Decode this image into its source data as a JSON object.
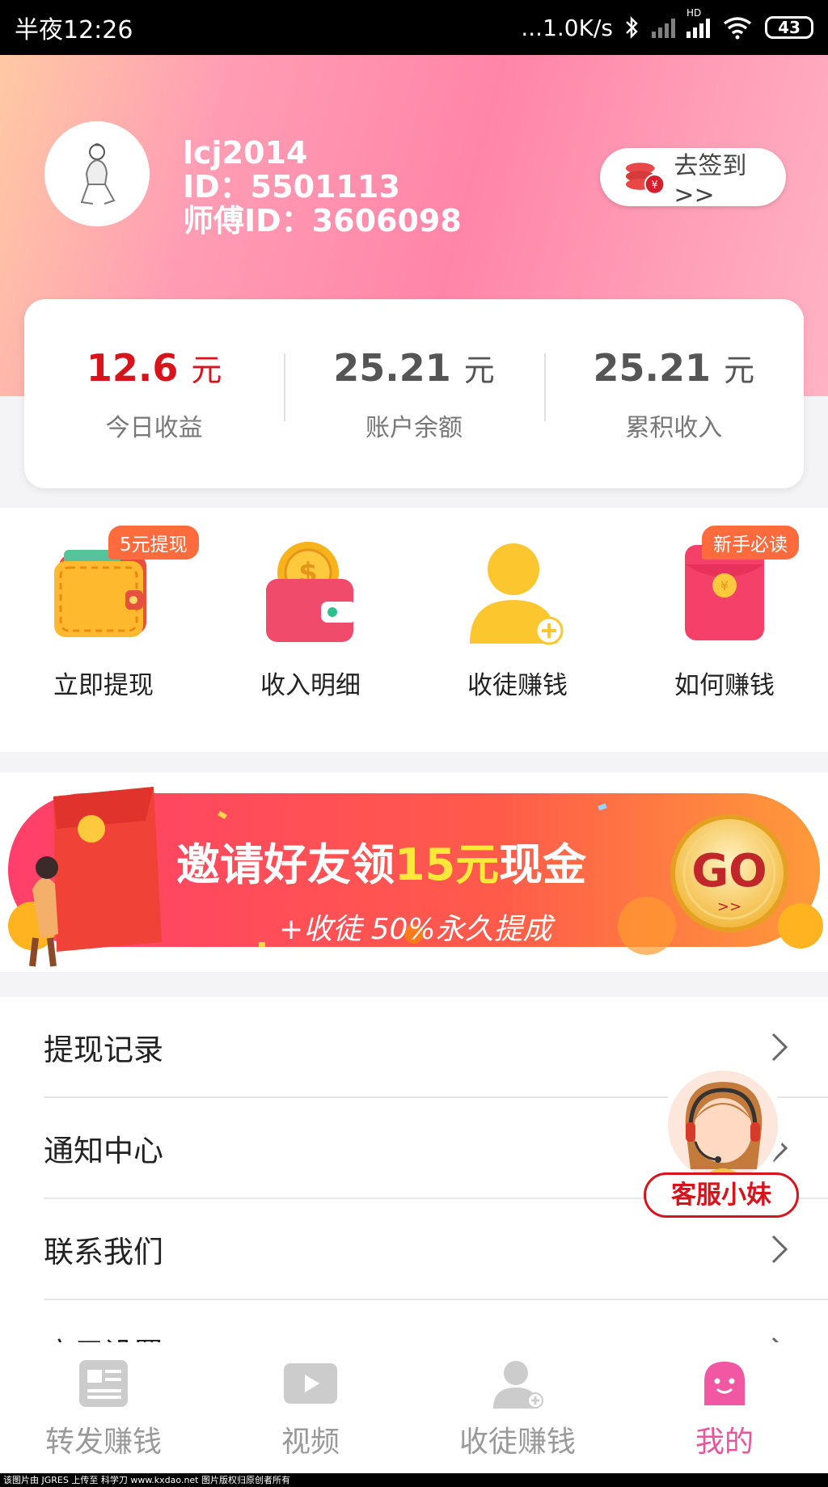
{
  "status_bar": {
    "time": "半夜12:26",
    "net_speed": "...1.0K/s",
    "hd": "HD",
    "battery": "43"
  },
  "profile": {
    "username": "lcj2014",
    "id_line": "ID：5501113",
    "master_id_line": "师傅ID：3606098",
    "checkin_label": "去签到>>"
  },
  "stats": [
    {
      "value": "12.6",
      "unit": "元",
      "label": "今日收益"
    },
    {
      "value": "25.21",
      "unit": "元",
      "label": "账户余额"
    },
    {
      "value": "25.21",
      "unit": "元",
      "label": "累积收入"
    }
  ],
  "actions": [
    {
      "label": "立即提现",
      "badge": "5元提现",
      "icon": "wallet-icon"
    },
    {
      "label": "收入明细",
      "badge": "",
      "icon": "coin-purse-icon"
    },
    {
      "label": "收徒赚钱",
      "badge": "",
      "icon": "add-user-icon"
    },
    {
      "label": "如何赚钱",
      "badge": "新手必读",
      "icon": "red-envelope-icon"
    }
  ],
  "banner": {
    "title_part1": "邀请好友领",
    "title_highlight": "15元",
    "title_part2": "现金",
    "subtitle": "+收徒 50%永久提成",
    "go_label": "GO"
  },
  "menu": [
    {
      "label": "提现记录"
    },
    {
      "label": "通知中心"
    },
    {
      "label": "联系我们"
    },
    {
      "label": "应用设置"
    }
  ],
  "service": {
    "label": "客服小妹"
  },
  "nav": [
    {
      "label": "转发赚钱",
      "icon": "news-icon",
      "active": false
    },
    {
      "label": "视频",
      "icon": "video-icon",
      "active": false
    },
    {
      "label": "收徒赚钱",
      "icon": "user-add-icon",
      "active": false
    },
    {
      "label": "我的",
      "icon": "smiley-icon",
      "active": true
    }
  ],
  "footer_text": "该图片由 JGRES 上传至 科学刀 www.kxdao.net 图片版权归原创者所有",
  "colors": {
    "accent_pink": "#e8559a",
    "highlight_red": "#d7141c",
    "badge_orange": "#ff6b3d"
  }
}
